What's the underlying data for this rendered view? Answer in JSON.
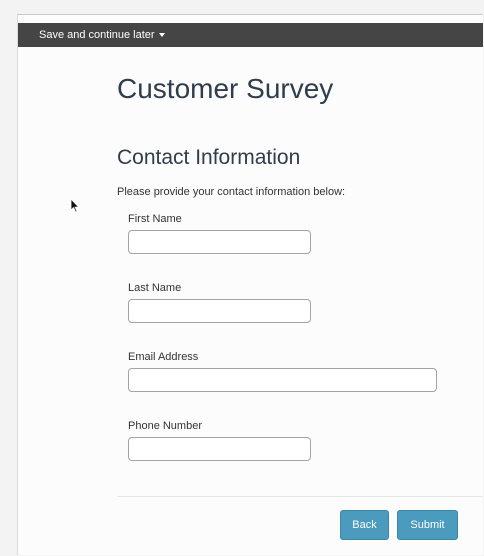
{
  "toolbar": {
    "save_later_label": "Save and continue later",
    "save_later_icon": "caret-down-icon"
  },
  "survey": {
    "title": "Customer Survey",
    "section_title": "Contact Information",
    "intro": "Please provide your contact information below:"
  },
  "fields": {
    "first_name": {
      "label": "First Name",
      "value": ""
    },
    "last_name": {
      "label": "Last Name",
      "value": ""
    },
    "email": {
      "label": "Email Address",
      "value": ""
    },
    "phone": {
      "label": "Phone Number",
      "value": ""
    }
  },
  "buttons": {
    "back_label": "Back",
    "submit_label": "Submit"
  },
  "colors": {
    "toolbar_bg": "#454545",
    "heading_text": "#2f3d4c",
    "button_bg": "#4a9bbd"
  },
  "icons": {
    "pointer": "mouse-pointer-icon"
  }
}
